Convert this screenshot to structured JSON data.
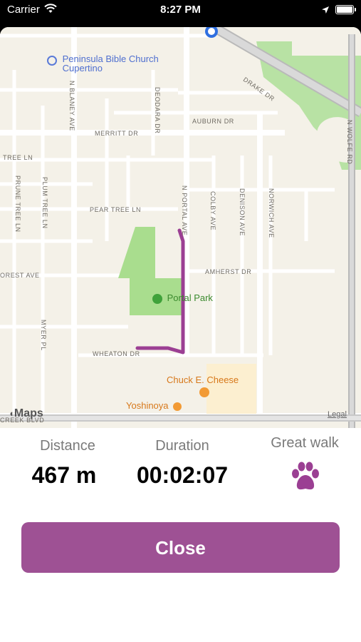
{
  "status_bar": {
    "carrier": "Carrier",
    "time": "8:27 PM",
    "icons": [
      "wifi-icon",
      "location-arrow-icon",
      "battery-icon"
    ]
  },
  "map": {
    "streets": [
      "N BLANEY AVE",
      "DEODARA DR",
      "DRAKE DR",
      "AUBURN DR",
      "MERRITT DR",
      "N WOLFE RD",
      "TREE LN",
      "PRUNE TREE LN",
      "PLUM TREE LN",
      "PEAR TREE LN",
      "N PORTAL AVE",
      "COLBY AVE",
      "DENISON AVE",
      "NORWICH AVE",
      "OREST AVE",
      "AMHERST DR",
      "MYER PL",
      "WHEATON DR",
      "CREEK BLVD"
    ],
    "pois": {
      "church": "Peninsula Bible Church Cupertino",
      "park": "Portal Park",
      "restaurant1": "Chuck E. Cheese",
      "restaurant2": "Yoshinoya"
    },
    "attribution": "Maps",
    "legal": "Legal",
    "route_color": "#9b3f93"
  },
  "stats": {
    "distance_label": "Distance",
    "distance_value": "467 m",
    "duration_label": "Duration",
    "duration_value": "00:02:07",
    "rating_label": "Great walk",
    "rating_icon": "paw-icon"
  },
  "actions": {
    "close_label": "Close"
  },
  "colors": {
    "accent": "#9e5194",
    "map_background": "#f4f1e8",
    "park": "#a9dd8e"
  }
}
